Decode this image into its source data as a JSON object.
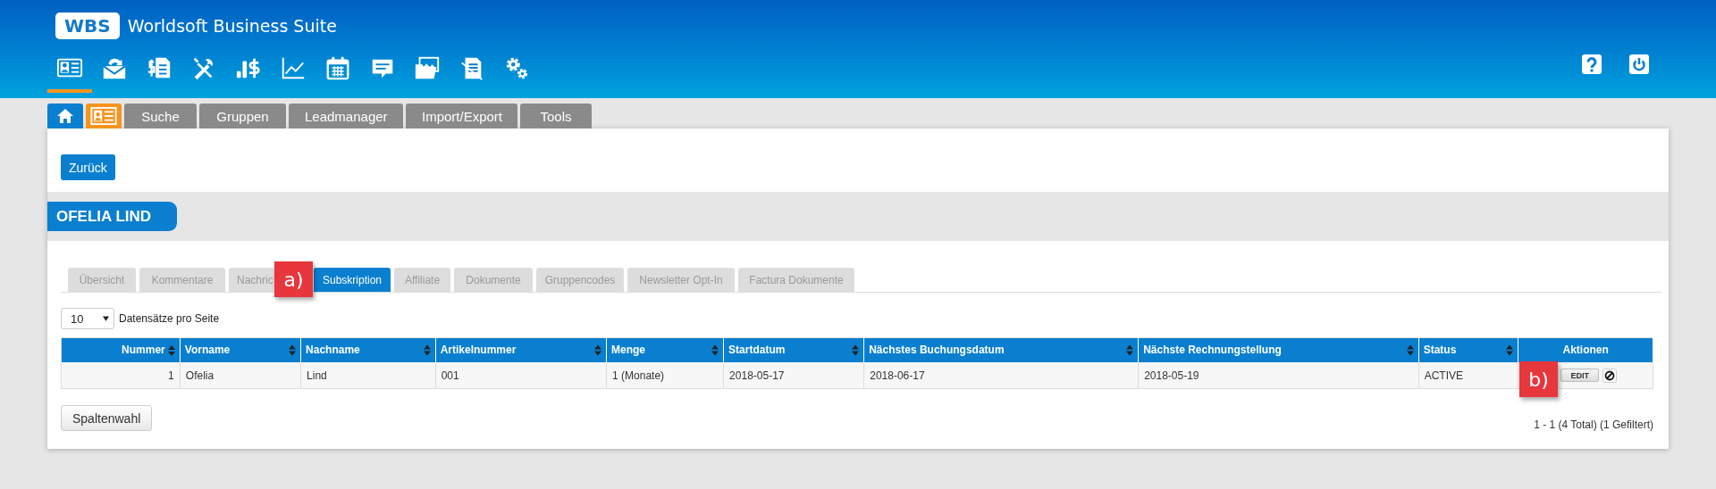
{
  "app": {
    "logo": "WBS",
    "title": "Worldsoft Business Suite"
  },
  "nav_icons": [
    {
      "kind": "contact-card",
      "selected": true
    },
    {
      "kind": "mail",
      "selected": false
    },
    {
      "kind": "invoice",
      "selected": false
    },
    {
      "kind": "tools",
      "selected": false
    },
    {
      "kind": "finance",
      "selected": false
    },
    {
      "kind": "chart",
      "selected": false
    },
    {
      "kind": "calendar",
      "selected": false
    },
    {
      "kind": "chat",
      "selected": false
    },
    {
      "kind": "folder",
      "selected": false
    },
    {
      "kind": "document",
      "selected": false
    },
    {
      "kind": "gears",
      "selected": false
    }
  ],
  "header_actions": [
    {
      "kind": "help"
    },
    {
      "kind": "power"
    }
  ],
  "tabs": [
    {
      "kind": "home",
      "selected": false
    },
    {
      "kind": "contact-card",
      "selected": true
    },
    {
      "kind": "text",
      "label": "Suche",
      "selected": false
    },
    {
      "kind": "text",
      "label": "Gruppen",
      "selected": false
    },
    {
      "kind": "text",
      "label": "Leadmanager",
      "selected": false
    },
    {
      "kind": "text",
      "label": "Import/Export",
      "selected": false
    },
    {
      "kind": "text",
      "label": "Tools",
      "selected": false
    }
  ],
  "back_button": "Zurück",
  "contact_name": "OFELIA LIND",
  "subtabs": [
    {
      "label": "Übersicht",
      "selected": false
    },
    {
      "label": "Kommentare",
      "selected": false
    },
    {
      "label": "Nachric",
      "selected": false
    },
    {
      "label": "Subskription",
      "selected": true
    },
    {
      "label": "Affiliate",
      "selected": false
    },
    {
      "label": "Dokumente",
      "selected": false
    },
    {
      "label": "Gruppencodes",
      "selected": false
    },
    {
      "label": "Newsletter Opt-In",
      "selected": false
    },
    {
      "label": "Factura Dokumente",
      "selected": false
    }
  ],
  "page_size": {
    "value": "10",
    "label": "Datensätze pro Seite"
  },
  "table": {
    "columns": [
      {
        "label": "Nummer",
        "sortable": true
      },
      {
        "label": "Vorname",
        "sortable": true
      },
      {
        "label": "Nachname",
        "sortable": true
      },
      {
        "label": "Artikelnummer",
        "sortable": true
      },
      {
        "label": "Menge",
        "sortable": true
      },
      {
        "label": "Startdatum",
        "sortable": true
      },
      {
        "label": "Nächstes Buchungsdatum",
        "sortable": true
      },
      {
        "label": "Nächste Rechnungstellung",
        "sortable": true
      },
      {
        "label": "Status",
        "sortable": true
      },
      {
        "label": "Aktionen",
        "sortable": false
      }
    ],
    "rows": [
      {
        "cells": [
          "1",
          "Ofelia",
          "Lind",
          "001",
          "1 (Monate)",
          "2018-05-17",
          "2018-06-17",
          "2018-05-19",
          "ACTIVE"
        ],
        "edit_button": "EDIT"
      }
    ]
  },
  "column_button": "Spaltenwahl",
  "pagination": "1 - 1 (4 Total) (1 Gefiltert)",
  "callouts": [
    {
      "label": "a)",
      "kind": "tabs"
    },
    {
      "label": "b)",
      "kind": "actions"
    }
  ]
}
